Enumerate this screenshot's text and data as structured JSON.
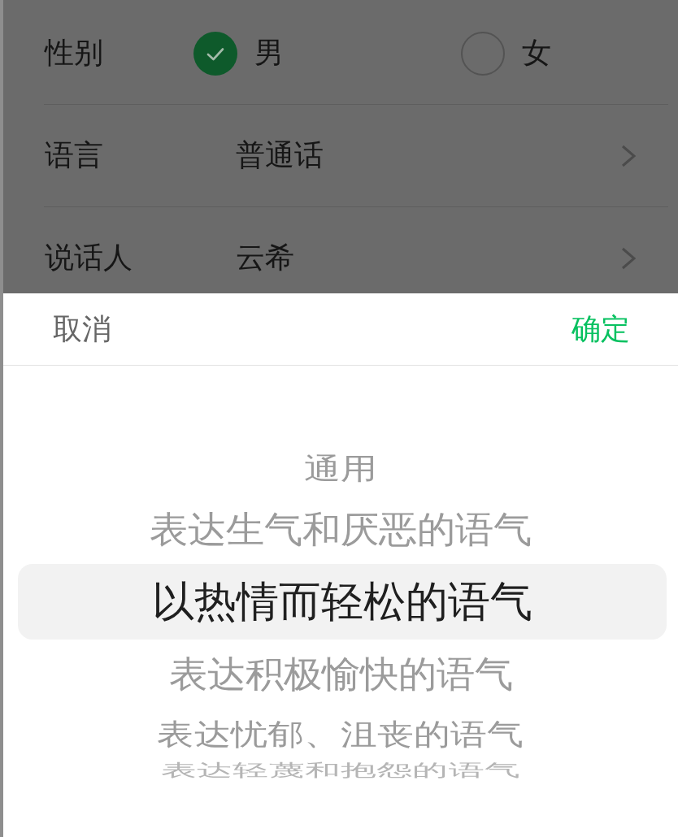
{
  "form": {
    "rows": [
      {
        "kind": "radio",
        "label": "性别",
        "options": [
          {
            "label": "男",
            "selected": true
          },
          {
            "label": "女",
            "selected": false
          }
        ]
      },
      {
        "kind": "select",
        "label": "语言",
        "value": "普通话"
      },
      {
        "kind": "select",
        "label": "说话人",
        "value": "云希"
      }
    ]
  },
  "sheet": {
    "cancel": "取消",
    "confirm": "确定",
    "options": [
      {
        "label": "通用",
        "selected": false
      },
      {
        "label": "表达生气和厌恶的语气",
        "selected": false
      },
      {
        "label": "以热情而轻松的语气",
        "selected": true
      },
      {
        "label": "表达积极愉快的语气",
        "selected": false
      },
      {
        "label": "表达忧郁、沮丧的语气",
        "selected": false
      },
      {
        "label": "表达轻蔑和抱怨的语气",
        "selected": false
      }
    ]
  }
}
